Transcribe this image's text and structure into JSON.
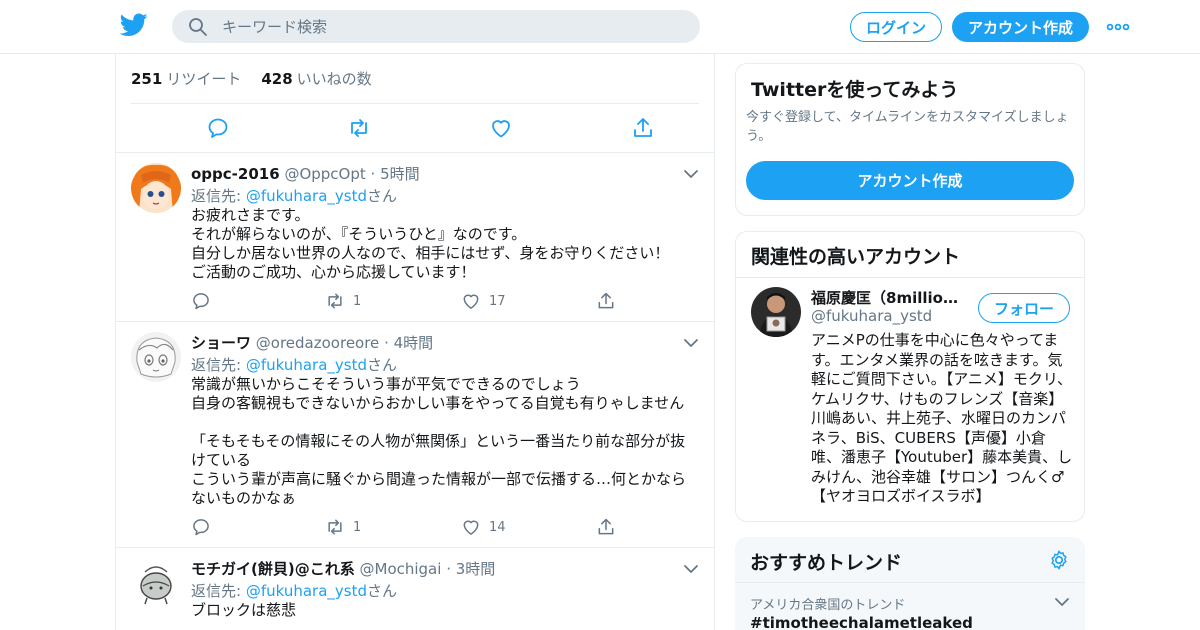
{
  "header": {
    "search_placeholder": "キーワード検索",
    "login_label": "ログイン",
    "signup_label": "アカウント作成"
  },
  "stats": {
    "retweets_count": "251",
    "retweets_label": "リツイート",
    "likes_count": "428",
    "likes_label": "いいねの数"
  },
  "replies": [
    {
      "name": "oppc-2016",
      "handle": "@OppcOpt",
      "time": "· 5時間",
      "reply_prefix": "返信先: ",
      "reply_mention": "@fukuhara_ystd",
      "reply_suffix": "さん",
      "text": "お疲れさまです。\nそれが解らないのが、『そういうひと』なのです。\n自分しか居ない世界の人なので、相手にはせず、身をお守りください！\nご活動のご成功、心から応援しています！",
      "retweets": "1",
      "likes": "17"
    },
    {
      "name": "ショーワ",
      "handle": "@oredazooreore",
      "time": "· 4時間",
      "reply_prefix": "返信先: ",
      "reply_mention": "@fukuhara_ystd",
      "reply_suffix": "さん",
      "text": "常識が無いからこそそういう事が平気でできるのでしょう\n自身の客観視もできないからおかしい事をやってる自覚も有りゃしません\n\n「そもそもその情報にその人物が無関係」という一番当たり前な部分が抜けている\nこういう輩が声高に騒ぐから間違った情報が一部で伝播する…何とかならないものかなぁ",
      "retweets": "1",
      "likes": "14"
    },
    {
      "name": "モチガイ(餅貝)@これ系",
      "handle": "@Mochigai",
      "time": "· 3時間",
      "reply_prefix": "返信先: ",
      "reply_mention": "@fukuhara_ystd",
      "reply_suffix": "さん",
      "text": "ブロックは慈悲"
    }
  ],
  "signup_card": {
    "title": "Twitterを使ってみよう",
    "subtitle": "今すぐ登録して、タイムラインをカスタマイズしましょう。",
    "cta_label": "アカウント作成"
  },
  "related_card": {
    "title": "関連性の高いアカウント",
    "account_name": "福原慶匡（8million…",
    "account_handle": "@fukuhara_ystd",
    "follow_label": "フォロー",
    "bio": "アニメPの仕事を中心に色々やってます。エンタメ業界の話を呟きます。気軽にご質問下さい。【アニメ】モクリ、ケムリクサ、けものフレンズ【音楽】川嶋あい、井上苑子、水曜日のカンパネラ、BiS、CUBERS【声優】小倉唯、潘恵子【Youtuber】藤本美貴、しみけん、池谷幸雄【サロン】つんく♂【ヤオヨロズボイスラボ】"
  },
  "trends_card": {
    "title": "おすすめトレンド",
    "location": "アメリカ合衆国のトレンド",
    "trend_tag": "#timotheechalametleaked"
  },
  "colors": {
    "accent": "#1da1f2",
    "text": "#14171a",
    "secondary_text": "#657786",
    "border": "#e6ecf0"
  },
  "icons": [
    "twitter-logo-icon",
    "search-icon",
    "more-icon",
    "reply-icon",
    "retweet-icon",
    "like-icon",
    "share-icon",
    "chevron-down-icon",
    "gear-icon"
  ]
}
